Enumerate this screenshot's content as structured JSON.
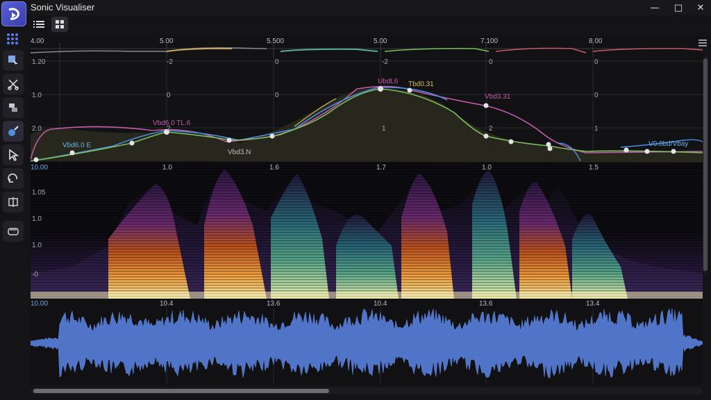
{
  "window": {
    "title": "Sonic Visualiser"
  },
  "top_ruler": {
    "ticks": [
      "4.00",
      "5.00",
      "5.500",
      "5.00",
      "7.100",
      "8.00"
    ]
  },
  "curve_pane": {
    "y_labels": [
      "1.20",
      "1.0",
      "2.0"
    ],
    "inner_labels": [
      "-2",
      "0",
      "-2",
      "0",
      "0",
      "0",
      "0",
      "0",
      "1",
      "1",
      "2",
      "2"
    ],
    "annotations": [
      "Vbd6.0 TL.6",
      "Vbd6.0 E",
      "Vbd3.N",
      "UbdL6",
      "Tbd0.31",
      "Vbd3.31",
      "V0.0bd/Vbay"
    ]
  },
  "spectrogram": {
    "time_ticks": [
      "10.00",
      "1.0",
      "1.6",
      "1.7",
      "1.0",
      "1.5"
    ],
    "y_labels": [
      "1.05",
      "1.0",
      "1.0",
      "-0"
    ]
  },
  "waveform": {
    "time_ticks": [
      "10.00",
      "10.4",
      "13.6",
      "10.4",
      "13.6",
      "13.4"
    ]
  },
  "colors": {
    "accent": "#4f63d8",
    "waveform": "#4f74c8",
    "curve_magenta": "#c35aa8",
    "curve_green": "#7fbf5a",
    "curve_blue": "#4a8de0",
    "curve_yellow": "#d4c05a"
  }
}
